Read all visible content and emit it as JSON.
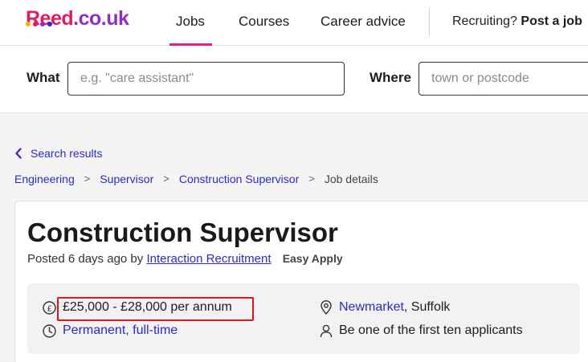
{
  "logo": {
    "brand": "Reed",
    "tld": ".co.uk",
    "dot_colors": [
      "#f7b500",
      "#e31b5c",
      "#8e2fbf",
      "#2a2ad4"
    ]
  },
  "nav": {
    "items": [
      "Jobs",
      "Courses",
      "Career advice"
    ],
    "active": "Jobs",
    "recruit_prefix": "Recruiting?",
    "recruit_link": "Post a job"
  },
  "search": {
    "what_label": "What",
    "what_placeholder": "e.g. \"care assistant\"",
    "where_label": "Where",
    "where_placeholder": "town or postcode"
  },
  "back_link": {
    "icon": "chevron-left-icon",
    "label": "Search results"
  },
  "breadcrumb": {
    "items": [
      "Engineering",
      "Supervisor",
      "Construction Supervisor"
    ],
    "current": "Job details"
  },
  "job": {
    "title": "Construction Supervisor",
    "posted_prefix": "Posted 6 days ago by",
    "company": "Interaction Recruitment",
    "apply_type": "Easy Apply",
    "salary": "£25,000 - £28,000 per annum",
    "job_type_link": "Permanent, full-time",
    "location_link": "Newmarket",
    "location_rest": ", Suffolk",
    "applicants": "Be one of the first ten applicants"
  },
  "colors": {
    "accent": "#e91e8c",
    "link": "#2a2ad4",
    "highlight": "#e0141a"
  }
}
